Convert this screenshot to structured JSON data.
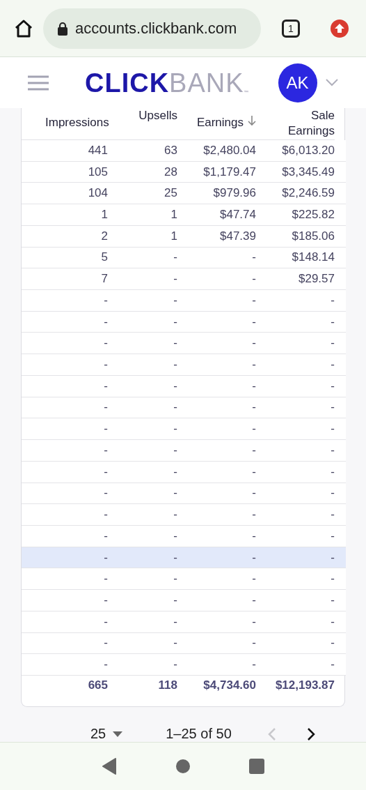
{
  "browser": {
    "url": "accounts.clickbank.com",
    "tab_count": "1"
  },
  "header": {
    "logo_primary": "CLICK",
    "logo_secondary": "BANK",
    "logo_mark": "™",
    "avatar_initials": "AK"
  },
  "table": {
    "columns": [
      {
        "label": "Impressions",
        "sorted": false
      },
      {
        "label": "Upsells",
        "sorted": false
      },
      {
        "label": "Earnings",
        "sorted": true
      },
      {
        "label": "Sale Earnings",
        "sorted": false
      }
    ],
    "rows": [
      {
        "cells": [
          "441",
          "63",
          "$2,480.04",
          "$6,013.20"
        ],
        "highlighted": false
      },
      {
        "cells": [
          "105",
          "28",
          "$1,179.47",
          "$3,345.49"
        ],
        "highlighted": false
      },
      {
        "cells": [
          "104",
          "25",
          "$979.96",
          "$2,246.59"
        ],
        "highlighted": false
      },
      {
        "cells": [
          "1",
          "1",
          "$47.74",
          "$225.82"
        ],
        "highlighted": false
      },
      {
        "cells": [
          "2",
          "1",
          "$47.39",
          "$185.06"
        ],
        "highlighted": false
      },
      {
        "cells": [
          "5",
          "-",
          "-",
          "$148.14"
        ],
        "highlighted": false
      },
      {
        "cells": [
          "7",
          "-",
          "-",
          "$29.57"
        ],
        "highlighted": false
      },
      {
        "cells": [
          "-",
          "-",
          "-",
          "-"
        ],
        "highlighted": false
      },
      {
        "cells": [
          "-",
          "-",
          "-",
          "-"
        ],
        "highlighted": false
      },
      {
        "cells": [
          "-",
          "-",
          "-",
          "-"
        ],
        "highlighted": false
      },
      {
        "cells": [
          "-",
          "-",
          "-",
          "-"
        ],
        "highlighted": false
      },
      {
        "cells": [
          "-",
          "-",
          "-",
          "-"
        ],
        "highlighted": false
      },
      {
        "cells": [
          "-",
          "-",
          "-",
          "-"
        ],
        "highlighted": false
      },
      {
        "cells": [
          "-",
          "-",
          "-",
          "-"
        ],
        "highlighted": false
      },
      {
        "cells": [
          "-",
          "-",
          "-",
          "-"
        ],
        "highlighted": false
      },
      {
        "cells": [
          "-",
          "-",
          "-",
          "-"
        ],
        "highlighted": false
      },
      {
        "cells": [
          "-",
          "-",
          "-",
          "-"
        ],
        "highlighted": false
      },
      {
        "cells": [
          "-",
          "-",
          "-",
          "-"
        ],
        "highlighted": false
      },
      {
        "cells": [
          "-",
          "-",
          "-",
          "-"
        ],
        "highlighted": false
      },
      {
        "cells": [
          "-",
          "-",
          "-",
          "-"
        ],
        "highlighted": true
      },
      {
        "cells": [
          "-",
          "-",
          "-",
          "-"
        ],
        "highlighted": false
      },
      {
        "cells": [
          "-",
          "-",
          "-",
          "-"
        ],
        "highlighted": false
      },
      {
        "cells": [
          "-",
          "-",
          "-",
          "-"
        ],
        "highlighted": false
      },
      {
        "cells": [
          "-",
          "-",
          "-",
          "-"
        ],
        "highlighted": false
      },
      {
        "cells": [
          "-",
          "-",
          "-",
          "-"
        ],
        "highlighted": false
      }
    ],
    "totals": [
      "665",
      "118",
      "$4,734.60",
      "$12,193.87"
    ]
  },
  "pagination": {
    "page_size": "25",
    "range": "1–25 of 50",
    "prev_disabled": true,
    "next_disabled": false
  }
}
